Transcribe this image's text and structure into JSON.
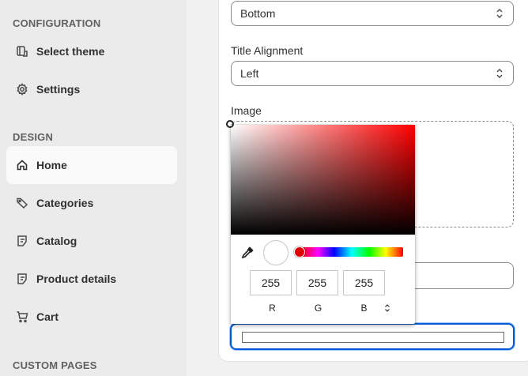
{
  "sidebar": {
    "configuration_title": "CONFIGURATION",
    "design_title": "DESIGN",
    "custom_pages_title": "CUSTOM PAGES",
    "config_items": [
      {
        "label": "Select theme",
        "icon": "theme-icon"
      },
      {
        "label": "Settings",
        "icon": "gear-icon"
      }
    ],
    "design_items": [
      {
        "label": "Home",
        "icon": "home-icon",
        "active": true
      },
      {
        "label": "Categories",
        "icon": "tag-icon"
      },
      {
        "label": "Catalog",
        "icon": "list-icon"
      },
      {
        "label": "Product details",
        "icon": "list-icon"
      },
      {
        "label": "Cart",
        "icon": "cart-icon"
      }
    ]
  },
  "form": {
    "position_value": "Bottom",
    "title_alignment_label": "Title Alignment",
    "title_alignment_value": "Left",
    "image_label": "Image"
  },
  "color_picker": {
    "r": "255",
    "g": "255",
    "b": "255",
    "r_label": "R",
    "g_label": "G",
    "b_label": "B",
    "selected_color": "#ffffff",
    "hue_color": "#ff0000"
  },
  "colors": {
    "focus_border": "#005bd3",
    "sidebar_bg": "#ebebeb",
    "active_item_bg": "#fafafa"
  }
}
